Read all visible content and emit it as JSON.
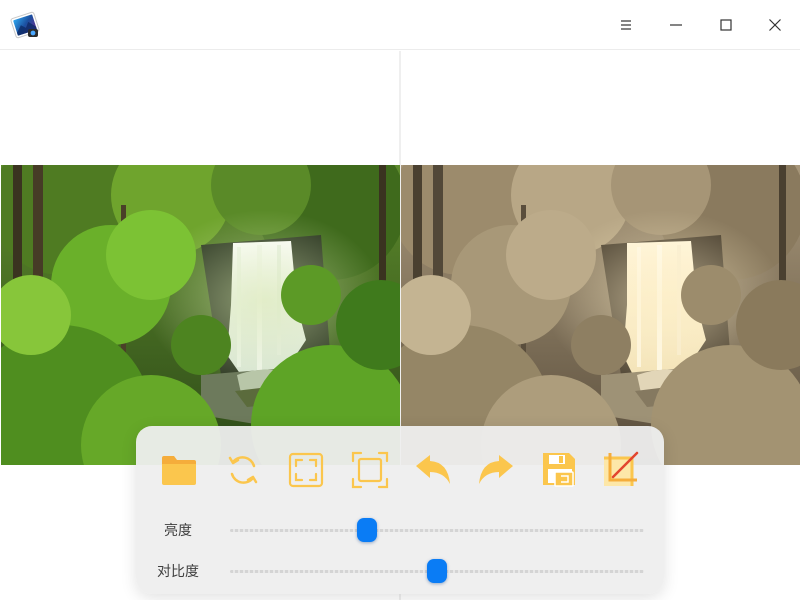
{
  "titlebar": {
    "icons": [
      "app-photo-icon",
      "menu-icon",
      "minimize-icon",
      "maximize-icon",
      "close-icon"
    ]
  },
  "images": {
    "original": {
      "subject": "forest-waterfall",
      "tone": "color"
    },
    "processed": {
      "subject": "forest-waterfall",
      "tone": "sepia"
    }
  },
  "toolbar": {
    "tools": [
      {
        "name": "open-folder-icon"
      },
      {
        "name": "rotate-icon"
      },
      {
        "name": "fit-window-icon"
      },
      {
        "name": "actual-size-icon"
      },
      {
        "name": "undo-icon"
      },
      {
        "name": "redo-icon"
      },
      {
        "name": "save-as-icon"
      },
      {
        "name": "crop-icon"
      }
    ],
    "accent_color": "#fbc64d"
  },
  "sliders": {
    "brightness": {
      "label": "亮度",
      "value": 0.33
    },
    "contrast": {
      "label": "对比度",
      "value": 0.5
    },
    "thumb_color": "#0a7cf5"
  }
}
